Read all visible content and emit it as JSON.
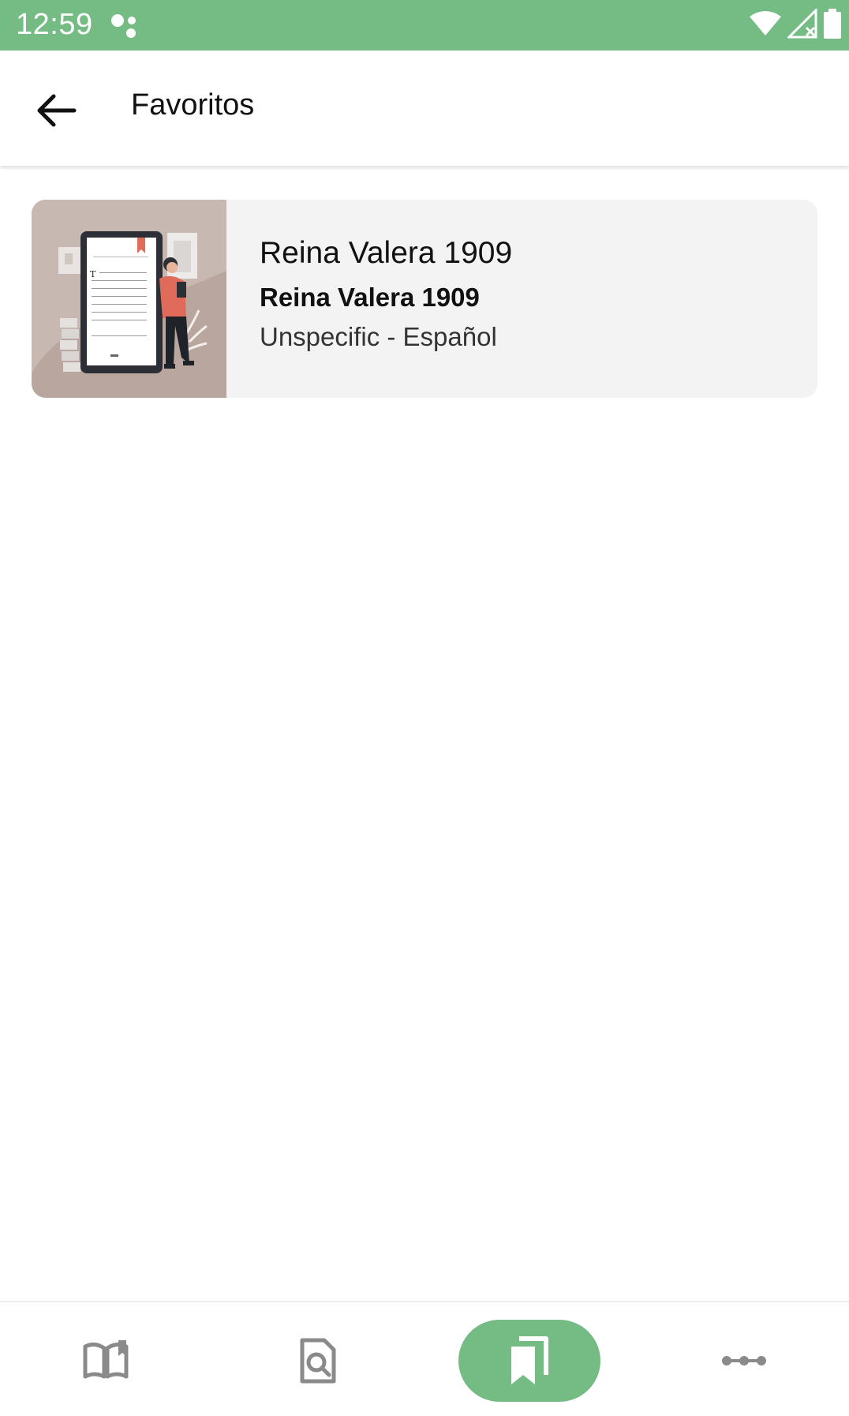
{
  "status_bar": {
    "time": "12:59",
    "icons": [
      "assistant-dots-icon",
      "wifi-icon",
      "no-signal-icon",
      "battery-icon"
    ]
  },
  "app_bar": {
    "title": "Favoritos",
    "back_icon": "arrow-left-icon"
  },
  "favorites": [
    {
      "title": "Reina Valera 1909",
      "subtitle": "Reina Valera 1909",
      "meta": "Unspecific - Español",
      "thumbnail": "reader-illustration"
    }
  ],
  "bottom_nav": {
    "items": [
      {
        "icon": "open-book-icon",
        "active": false
      },
      {
        "icon": "document-search-icon",
        "active": false
      },
      {
        "icon": "bookmarks-icon",
        "active": true
      },
      {
        "icon": "more-dots-icon",
        "active": false
      }
    ],
    "active_color": "#75bb84",
    "inactive_color": "#8a8a8a"
  },
  "colors": {
    "brand_green": "#75bb84",
    "card_background": "#f3f3f3",
    "thumbnail_background": "#b9a69e"
  }
}
